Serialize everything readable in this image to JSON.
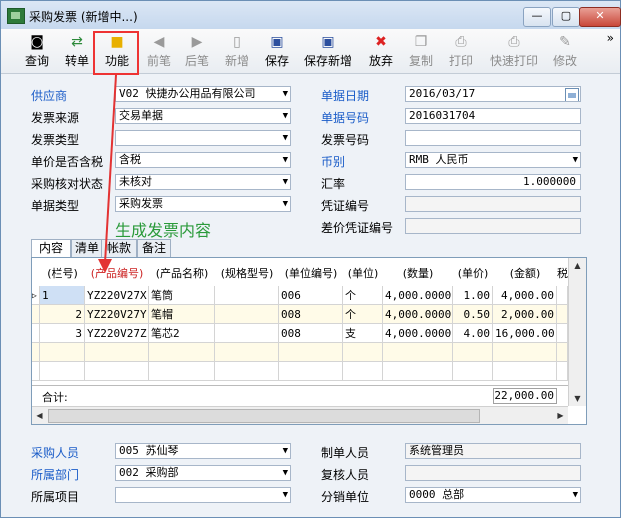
{
  "window": {
    "title": "采购发票 (新增中...)",
    "min": "—",
    "max": "▢",
    "close": "✕"
  },
  "toolbar": [
    {
      "label": "查询",
      "icon": "search-doc-icon",
      "glyph": "◙",
      "enabled": true
    },
    {
      "label": "转单",
      "icon": "transfer-icon",
      "glyph": "⇄",
      "enabled": true
    },
    {
      "label": "功能",
      "icon": "box-icon",
      "glyph": "■",
      "enabled": true
    },
    {
      "label": "前笔",
      "icon": "arrow-left-icon",
      "glyph": "◀",
      "enabled": false
    },
    {
      "label": "后笔",
      "icon": "arrow-right-icon",
      "glyph": "▶",
      "enabled": false
    },
    {
      "label": "新增",
      "icon": "new-doc-icon",
      "glyph": "▯",
      "enabled": false
    },
    {
      "label": "保存",
      "icon": "save-icon",
      "glyph": "▣",
      "enabled": true
    },
    {
      "label": "保存新增",
      "icon": "save-new-icon",
      "glyph": "▣",
      "enabled": true
    },
    {
      "label": "放弃",
      "icon": "cancel-icon",
      "glyph": "✖",
      "enabled": true
    },
    {
      "label": "复制",
      "icon": "copy-icon",
      "glyph": "❐",
      "enabled": false
    },
    {
      "label": "打印",
      "icon": "printer-icon",
      "glyph": "⎙",
      "enabled": false
    },
    {
      "label": "快速打印",
      "icon": "quick-print-icon",
      "glyph": "⎙",
      "enabled": false
    },
    {
      "label": "修改",
      "icon": "edit-icon",
      "glyph": "✎",
      "enabled": false
    }
  ],
  "toolbar_more": "»",
  "form": {
    "supplier": {
      "label": "供应商",
      "value": "V02 快捷办公用品有限公司"
    },
    "invoice_source": {
      "label": "发票来源",
      "value": "交易单据"
    },
    "invoice_type": {
      "label": "发票类型",
      "value": ""
    },
    "tax_included": {
      "label": "单价是否含税",
      "value": "含税"
    },
    "verify_status": {
      "label": "采购核对状态",
      "value": "未核对"
    },
    "doc_type": {
      "label": "单据类型",
      "value": "采购发票"
    },
    "doc_date": {
      "label": "单据日期",
      "value": "2016/03/17"
    },
    "doc_no": {
      "label": "单据号码",
      "value": "2016031704"
    },
    "invoice_no": {
      "label": "发票号码",
      "value": ""
    },
    "currency": {
      "label": "币别",
      "value": "RMB 人民币"
    },
    "exchange_rate": {
      "label": "汇率",
      "value": "1.000000"
    },
    "voucher_no": {
      "label": "凭证编号",
      "value": ""
    },
    "diff_voucher_no": {
      "label": "差价凭证编号",
      "value": ""
    }
  },
  "annotation": "生成发票内容",
  "tabs": [
    "内容",
    "清单",
    "帐款",
    "备注"
  ],
  "grid": {
    "columns": [
      "(栏号)",
      "(产品编号)",
      "(产品名称)",
      "(规格型号)",
      "(单位编号)",
      "(单位)",
      "(数量)",
      "(单价)",
      "(金额)",
      "税"
    ],
    "rows": [
      [
        "1",
        "YZ220V27X",
        "笔筒",
        "",
        "006",
        "个",
        "4,000.0000",
        "1.00",
        "4,000.00"
      ],
      [
        "2",
        "YZ220V27Y",
        "笔帽",
        "",
        "008",
        "个",
        "4,000.0000",
        "0.50",
        "2,000.00"
      ],
      [
        "3",
        "YZ220V27Z",
        "笔芯2",
        "",
        "008",
        "支",
        "4,000.0000",
        "4.00",
        "16,000.00"
      ]
    ],
    "row_marker": "▷",
    "total_label": "合计:",
    "total_value": "22,000.00"
  },
  "footer": {
    "purchaser": {
      "label": "采购人员",
      "value": "005 苏仙琴"
    },
    "department": {
      "label": "所属部门",
      "value": "002 采购部"
    },
    "project": {
      "label": "所属项目",
      "value": ""
    },
    "creator": {
      "label": "制单人员",
      "value": "系统管理员"
    },
    "reviewer": {
      "label": "复核人员",
      "value": ""
    },
    "branch": {
      "label": "分销单位",
      "value": "0000 总部"
    }
  },
  "colors": {
    "accent_label": "#1a5cc8",
    "annotation": "#2a9a3a",
    "highlight": "#e33333"
  }
}
